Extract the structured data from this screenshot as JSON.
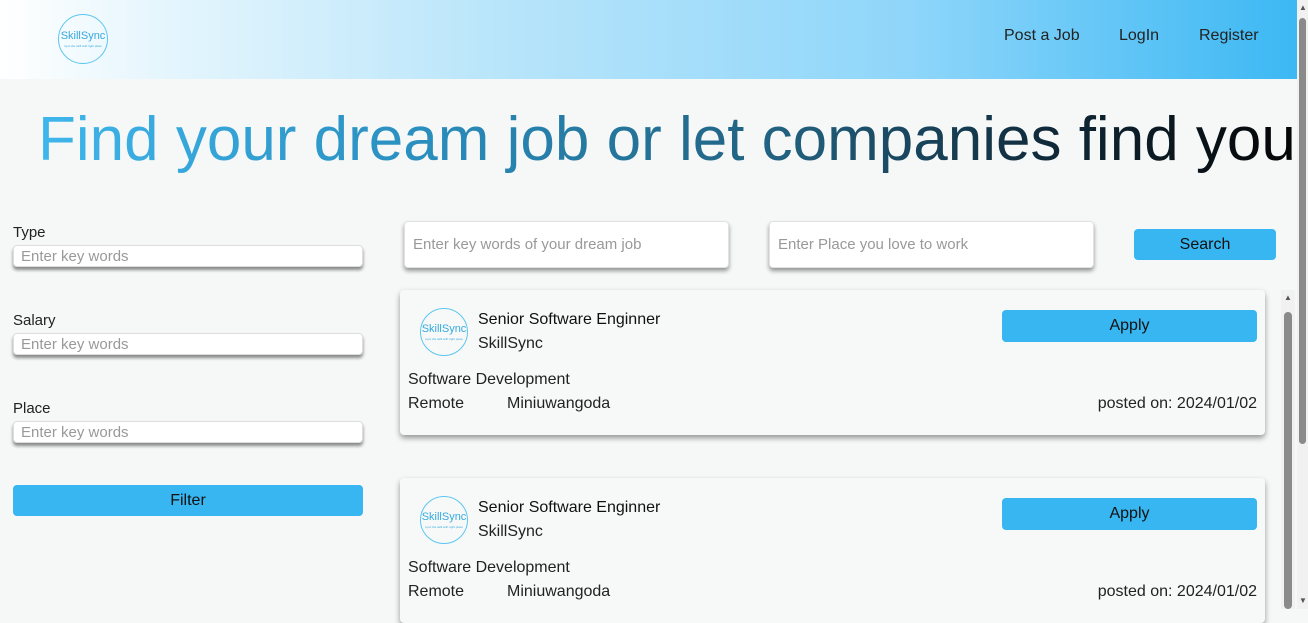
{
  "header": {
    "logo": {
      "name": "SkillSync",
      "tagline": "sync the skill with right place"
    },
    "nav": {
      "post_job": "Post a Job",
      "login": "LogIn",
      "register": "Register"
    }
  },
  "hero": {
    "title": "Find your dream job or let companies find you"
  },
  "filters": {
    "type_label": "Type",
    "salary_label": "Salary",
    "place_label": "Place",
    "placeholder": "Enter key words",
    "filter_button": "Filter"
  },
  "search": {
    "keywords_placeholder": "Enter key words of your dream job",
    "place_placeholder": "Enter Place you love to work",
    "button": "Search"
  },
  "jobs": [
    {
      "title": "Senior Software Enginner",
      "company": "SkillSync",
      "category": "Software Development",
      "mode": "Remote",
      "location": "Miniuwangoda",
      "posted": "posted on: 2024/01/02",
      "apply": "Apply",
      "logo_name": "SkillSync",
      "logo_tagline": "sync the skill with right place"
    },
    {
      "title": "Senior Software Enginner",
      "company": "SkillSync",
      "category": "Software Development",
      "mode": "Remote",
      "location": "Miniuwangoda",
      "posted": "posted on: 2024/01/02",
      "apply": "Apply",
      "logo_name": "SkillSync",
      "logo_tagline": "sync the skill with right place"
    }
  ],
  "colors": {
    "accent": "#38b6f1",
    "background": "#f6f8f8"
  }
}
